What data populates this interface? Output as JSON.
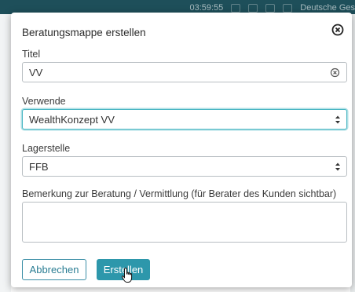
{
  "background": {
    "status_time": "03:59:55",
    "status_text": "Deutsche Ges"
  },
  "dialog": {
    "title": "Beratungsmappe erstellen",
    "close_icon": "circle-x-icon"
  },
  "form": {
    "titel": {
      "label": "Titel",
      "value": "VV"
    },
    "verwende": {
      "label": "Verwende",
      "value": "WealthKonzept VV",
      "focused": true
    },
    "lagerstelle": {
      "label": "Lagerstelle",
      "value": "FFB"
    },
    "bemerkung": {
      "label": "Bemerkung zur Beratung / Vermittlung (für Berater des Kunden sichtbar)",
      "value": ""
    }
  },
  "buttons": {
    "cancel_label": "Abbrechen",
    "create_label": "Erstellen"
  },
  "colors": {
    "accent": "#2d97ab",
    "focus_ring": "#4bb7c4",
    "topbar": "#1e4f5a"
  }
}
